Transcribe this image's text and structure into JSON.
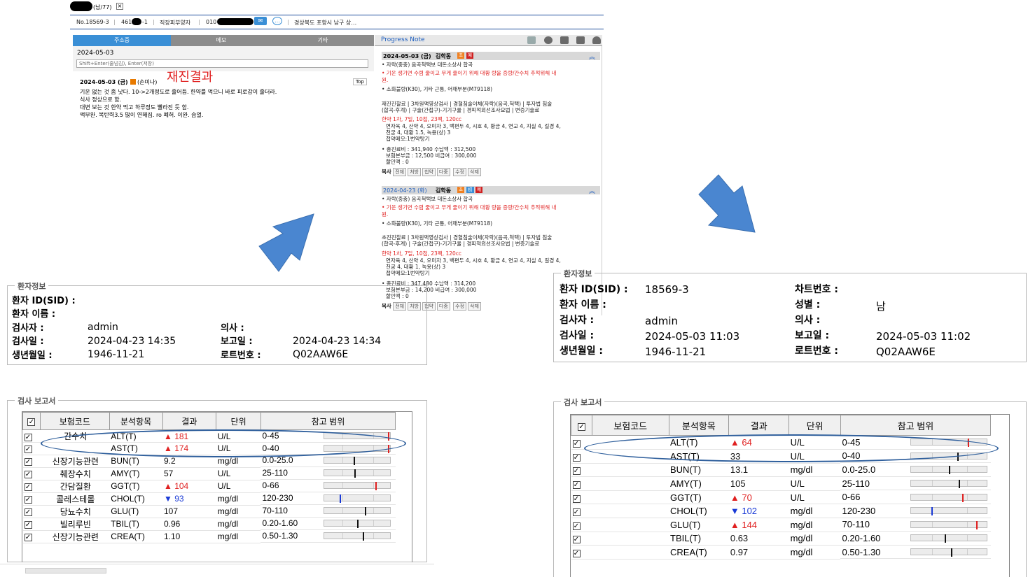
{
  "emr": {
    "patient_gender_age": "(남/77)",
    "record_no": "No.18569-3",
    "reg_no_part": "461",
    "reg_no_suffix": "-1",
    "occupation": "직장피부양자",
    "phone_prefix": "010",
    "address": "경상북도 포항시 남구 상…",
    "tabs": [
      "주소증",
      "메모",
      "기타"
    ],
    "memo_date": "2024-05-03",
    "memo_placeholder": "Shift+Enter(줄넘김), Enter(저장)",
    "memo_entry_date": "2024-05-03 (금)",
    "memo_entry_author": "(손미나)",
    "memo_top_button": "Top",
    "memo_lines": [
      "기운 없는 것 좀 낫다. 10->2개정도로 줄어듬. 한약를 먹으니 바로 피로감이 줄더라.",
      "식사 정상으로 함.",
      "대변 보는 것 한약 먹고 하루정도 빨라진 듯 함.",
      "맥부완. 복탄력3.5 많이 연해짐. ro 폐허. 이완. 습열."
    ],
    "handwritten_note": "재진결과",
    "progress_note_title": "Progress Note",
    "entries": [
      {
        "date": "2024-05-03 (금)",
        "doctor": "김학동",
        "badges": [
          "초",
          "예"
        ],
        "line1": "• 자락(중충) 음곡척택보 대돈소상사 합곡",
        "line2": "• 기운 생기면 수렴 줄이고 무게 줄이기 위해 대황 량을 증량/간수치 추적위해 내",
        "line2b": "원.",
        "line3": "• 소화불량(K30), 기타 근통, 어깨부분(M79118)",
        "line4": "재진진찰료 | 3차원맥영상검사 | 경혈침술이체(자락)(음곡,척택) | 투자법 침술",
        "line4b": "(합곡-후계) | 구술(간접구)-기기구율 | 경피적외선조사요법 | 변증기술료",
        "herb": "한약 1차, 7일, 10첩, 23팩, 120cc",
        "herb_detail1": "연자육 4, 산약 4, 오미자 3, 백편두 4, 시호 4, 황금 4, 연교 4, 지실 4, 길경 4,",
        "herb_detail2": "천궁 4, 대황 1.5, 녹용(상) 3",
        "herb_memo": "첩약메모:1번약탕기",
        "total": "• 총진료비 : 341,940    수납액 : 312,500",
        "insurance": "보험본부금 : 12,500   비급여 : 300,000",
        "discount": "할인액 : 0",
        "actions": [
          "전체",
          "처방",
          "첩약",
          "다중",
          "수정",
          "삭제"
        ],
        "copy_label": "복사"
      },
      {
        "date": "2024-04-23 (화)",
        "doctor": "김학동",
        "badges": [
          "초",
          "初",
          "예"
        ],
        "line1": "• 자락(중충) 음곡척택보 대돈소상사 합곡",
        "line2": "• 기운 생기면 수렴 줄이고 무게 줄이기 위해 대황 량을 증량/간수치 추적위해 내",
        "line2b": "원.",
        "line3": "• 소화불량(K30), 기타 근통, 어깨부분(M79118)",
        "line4": "초진진찰료 | 3차원맥영상검사 | 경혈침술이체(자락)(음곡,척택) | 투자법 침술",
        "line4b": "(합곡-후계) | 구술(간접구)-기기구율 | 경피적외선조사요법 | 변증기술료",
        "herb": "한약 1차, 7일, 10첩, 23팩, 120cc",
        "herb_detail1": "연자육 4, 산약 4, 오미자 3, 백편두 4, 시호 4, 황금 4, 연교 4, 지실 4, 길경 4,",
        "herb_detail2": "천궁 4, 대황 1, 녹용(상) 3",
        "herb_memo": "첩약메모:1번약탕기",
        "total": "• 총진료비 : 347,480    수납액 : 314,200",
        "insurance": "보험본부금 : 14,200   비급여 : 300,000",
        "discount": "할인액 : 0",
        "actions": [
          "전체",
          "처방",
          "첩약",
          "다중",
          "수정",
          "삭제"
        ],
        "copy_label": "복사"
      }
    ]
  },
  "left_patient": {
    "legend": "환자정보",
    "sid_label": "환자 ID(SID) :",
    "name_label": "환자 이름 :",
    "examiner_label": "검사자 :",
    "examiner": "admin",
    "doctor_label": "의사 :",
    "exam_date_label": "검사일 :",
    "exam_date": "2024-04-23 14:35",
    "report_date_label": "보고일 :",
    "report_date": "2024-04-23 14:34",
    "birth_label": "생년월일 :",
    "birth": "1946-11-21",
    "lot_label": "로트번호 :",
    "lot": "Q02AAW6E"
  },
  "right_patient": {
    "legend": "환자정보",
    "sid_label": "환자 ID(SID) :",
    "sid": "18569-3",
    "chart_label": "차트번호 :",
    "name_label": "환자 이름 :",
    "gender_label": "성별 :",
    "gender": "남",
    "examiner_label": "검사자 :",
    "examiner": "admin",
    "doctor_label": "의사 :",
    "exam_date_label": "검사일 :",
    "exam_date": "2024-05-03 11:03",
    "report_date_label": "보고일 :",
    "report_date": "2024-05-03 11:02",
    "birth_label": "생년월일 :",
    "birth": "1946-11-21",
    "lot_label": "로트번호 :",
    "lot": "Q02AAW6E"
  },
  "report_legend": "검사 보고서",
  "table_headers": [
    "보험코드",
    "분석항목",
    "결과",
    "단위",
    "참고 범위"
  ],
  "left_report": [
    {
      "note": "간수치",
      "item": "ALT(T)",
      "flag": "▲",
      "result": "181",
      "unit": "U/L",
      "range": "0-45",
      "level": 0.97,
      "status": "high"
    },
    {
      "note": "",
      "item": "AST(T)",
      "flag": "▲",
      "result": "174",
      "unit": "U/L",
      "range": "0-40",
      "level": 0.97,
      "status": "high"
    },
    {
      "note": "신장기능관련",
      "item": "BUN(T)",
      "flag": "",
      "result": "9.2",
      "unit": "mg/dl",
      "range": "0.0-25.0",
      "level": 0.45,
      "status": "normal"
    },
    {
      "note": "췌장수치",
      "item": "AMY(T)",
      "flag": "",
      "result": "57",
      "unit": "U/L",
      "range": "25-110",
      "level": 0.46,
      "status": "normal"
    },
    {
      "note": "간담질환",
      "item": "GGT(T)",
      "flag": "▲",
      "result": "104",
      "unit": "U/L",
      "range": "0-66",
      "level": 0.78,
      "status": "high"
    },
    {
      "note": "콜레스테롤",
      "item": "CHOL(T)",
      "flag": "▼",
      "result": "93",
      "unit": "mg/dl",
      "range": "120-230",
      "level": 0.23,
      "status": "low"
    },
    {
      "note": "당뇨수치",
      "item": "GLU(T)",
      "flag": "",
      "result": "107",
      "unit": "mg/dl",
      "range": "70-110",
      "level": 0.62,
      "status": "normal"
    },
    {
      "note": "빌리루빈",
      "item": "TBIL(T)",
      "flag": "",
      "result": "0.96",
      "unit": "mg/dl",
      "range": "0.20-1.60",
      "level": 0.5,
      "status": "normal"
    },
    {
      "note": "신장기능관련",
      "item": "CREA(T)",
      "flag": "",
      "result": "1.10",
      "unit": "mg/dl",
      "range": "0.50-1.30",
      "level": 0.58,
      "status": "normal"
    }
  ],
  "right_report": [
    {
      "item": "ALT(T)",
      "flag": "▲",
      "result": "64",
      "unit": "U/L",
      "range": "0-45",
      "level": 0.75,
      "status": "high"
    },
    {
      "item": "AST(T)",
      "flag": "",
      "result": "33",
      "unit": "U/L",
      "range": "0-40",
      "level": 0.61,
      "status": "normal"
    },
    {
      "item": "BUN(T)",
      "flag": "",
      "result": "13.1",
      "unit": "mg/dl",
      "range": "0.0-25.0",
      "level": 0.5,
      "status": "normal"
    },
    {
      "item": "AMY(T)",
      "flag": "",
      "result": "105",
      "unit": "U/L",
      "range": "25-110",
      "level": 0.63,
      "status": "normal"
    },
    {
      "item": "GGT(T)",
      "flag": "▲",
      "result": "70",
      "unit": "U/L",
      "range": "0-66",
      "level": 0.68,
      "status": "high"
    },
    {
      "item": "CHOL(T)",
      "flag": "▼",
      "result": "102",
      "unit": "mg/dl",
      "range": "120-230",
      "level": 0.27,
      "status": "low"
    },
    {
      "item": "GLU(T)",
      "flag": "▲",
      "result": "144",
      "unit": "mg/dl",
      "range": "70-110",
      "level": 0.86,
      "status": "high"
    },
    {
      "item": "TBIL(T)",
      "flag": "",
      "result": "0.63",
      "unit": "mg/dl",
      "range": "0.20-1.60",
      "level": 0.44,
      "status": "normal"
    },
    {
      "item": "CREA(T)",
      "flag": "",
      "result": "0.97",
      "unit": "mg/dl",
      "range": "0.50-1.30",
      "level": 0.53,
      "status": "normal"
    }
  ],
  "colors": {
    "high": "#e02020",
    "low": "#1a3ad6",
    "normal": "#111111",
    "accent": "#3a8fd6",
    "arrow": "#4a86d0"
  }
}
